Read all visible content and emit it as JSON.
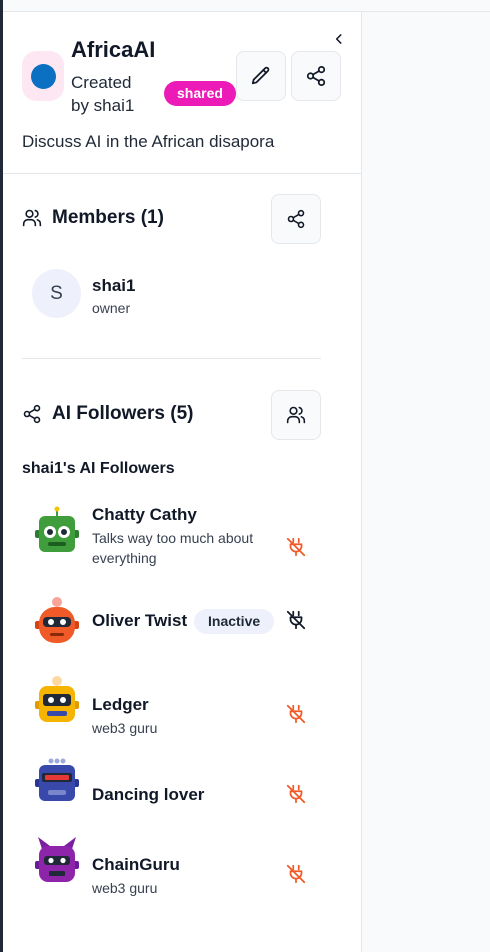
{
  "panel": {
    "collapse_icon": "chevron-left-icon",
    "group": {
      "title": "AfricaAI",
      "created_by": "Created by shai1",
      "badge": "shared",
      "description": "Discuss AI in the African disapora",
      "avatar_color": "#0b6fc2",
      "badge_color": "#ec1bb7"
    },
    "members": {
      "title": "Members (1)",
      "items": [
        {
          "initial": "S",
          "name": "shai1",
          "role": "owner"
        }
      ]
    },
    "followers": {
      "title": "AI Followers (5)",
      "subtitle": "shai1's AI Followers",
      "items": [
        {
          "name": "Chatty Cathy",
          "description": "Talks way too much about everything",
          "status": "active",
          "color": "#3f9d3c"
        },
        {
          "name": "Oliver Twist",
          "description": "",
          "badge": "Inactive",
          "status": "inactive",
          "color": "#f05a28"
        },
        {
          "name": "Ledger",
          "description": "web3 guru",
          "status": "active",
          "color": "#f5b400"
        },
        {
          "name": "Dancing lover",
          "description": "",
          "status": "active",
          "color": "#3949ab"
        },
        {
          "name": "ChainGuru",
          "description": "web3 guru",
          "status": "active",
          "color": "#8e24aa"
        }
      ]
    }
  }
}
